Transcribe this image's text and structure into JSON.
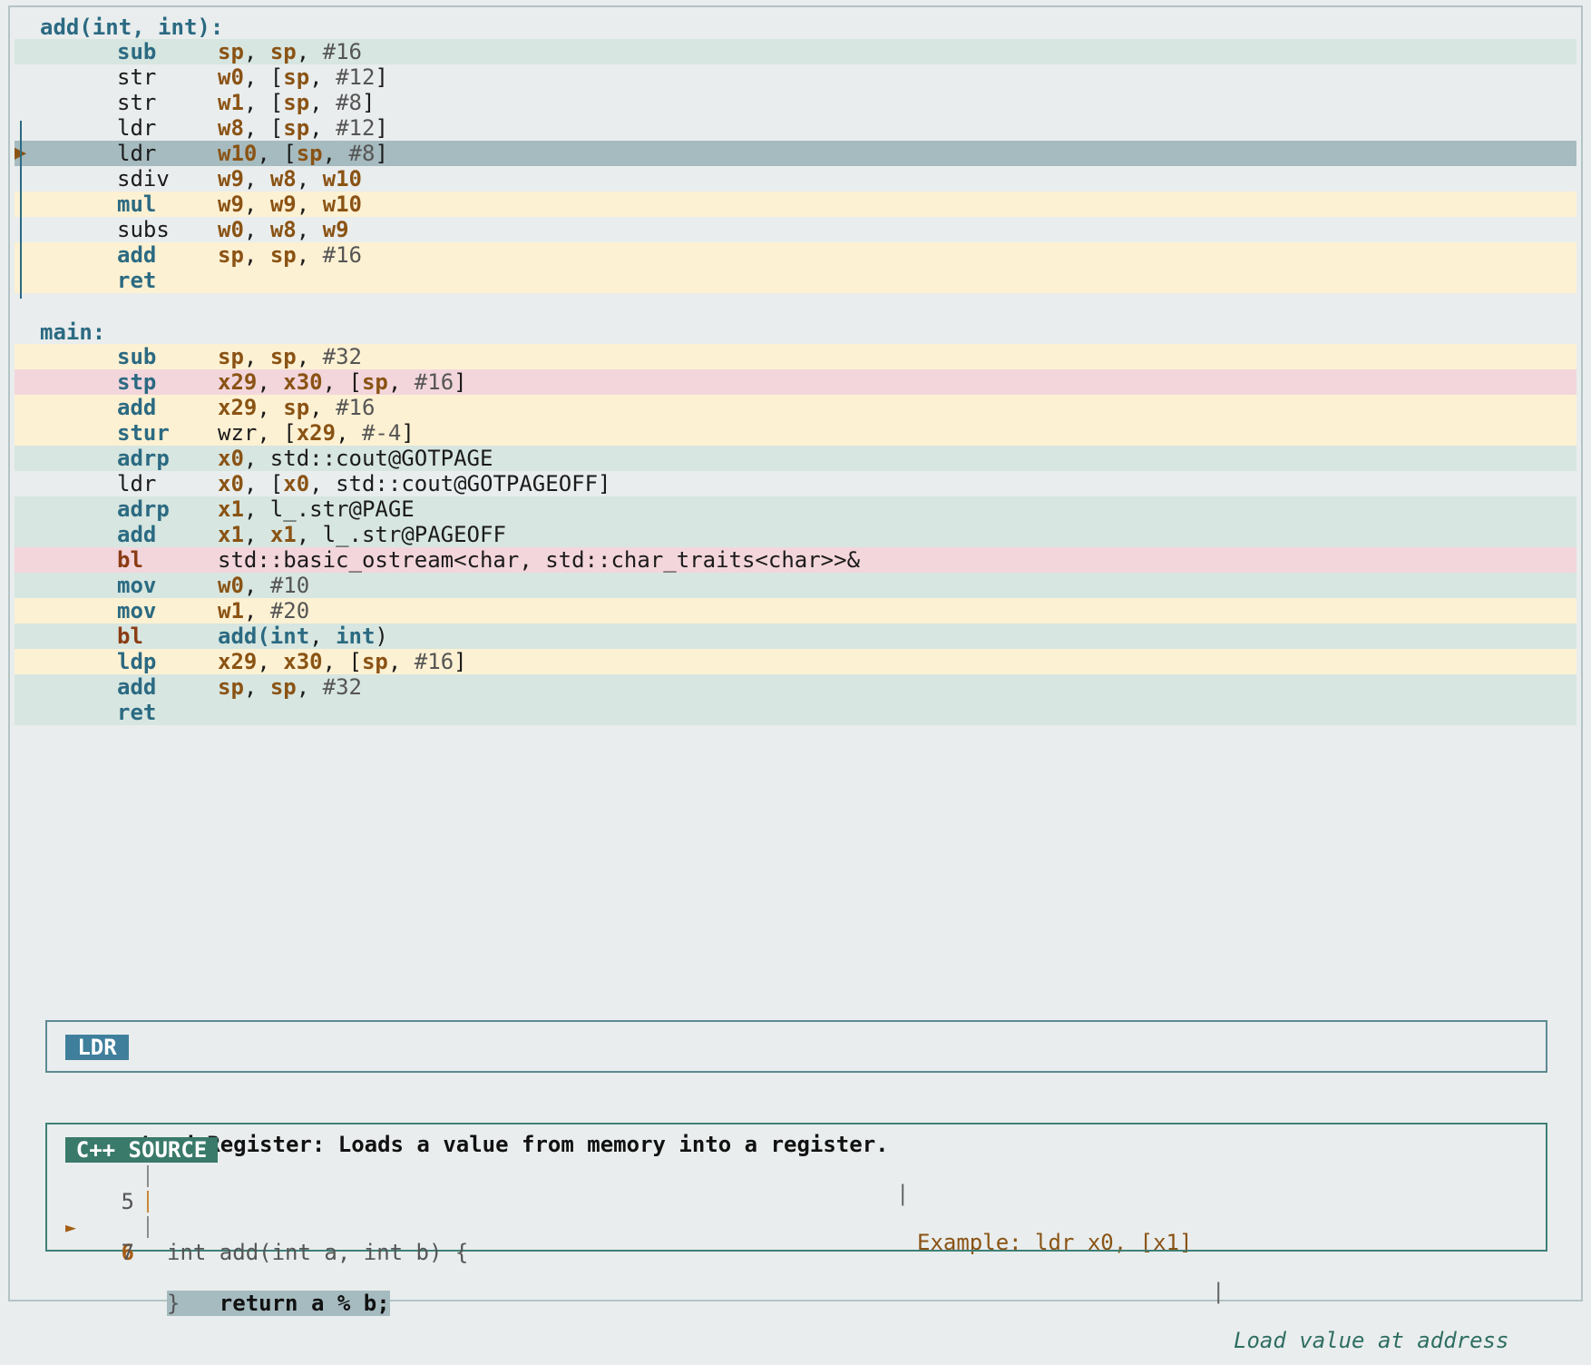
{
  "colors": {
    "green": "#d7e6e0",
    "yellow": "#fdf1d3",
    "pink": "#f3d6dc",
    "current": "#a6bbc0",
    "plain": "transparent"
  },
  "asm": {
    "labels": [
      "add(int, int):",
      "main:"
    ],
    "add_fn": [
      {
        "mn": "sub",
        "mnStyle": "b",
        "ops": [
          {
            "t": "sp",
            "c": "reg"
          },
          {
            "t": ", "
          },
          {
            "t": "sp",
            "c": "reg"
          },
          {
            "t": ", "
          },
          {
            "t": "#16",
            "c": "imm"
          }
        ],
        "bg": "green"
      },
      {
        "mn": "str",
        "mnStyle": "n",
        "ops": [
          {
            "t": "w0",
            "c": "reg"
          },
          {
            "t": ", ["
          },
          {
            "t": "sp",
            "c": "reg"
          },
          {
            "t": ", "
          },
          {
            "t": "#12",
            "c": "imm"
          },
          {
            "t": "]"
          }
        ],
        "bg": "plain"
      },
      {
        "mn": "str",
        "mnStyle": "n",
        "ops": [
          {
            "t": "w1",
            "c": "reg"
          },
          {
            "t": ", ["
          },
          {
            "t": "sp",
            "c": "reg"
          },
          {
            "t": ", "
          },
          {
            "t": "#8",
            "c": "imm"
          },
          {
            "t": "]"
          }
        ],
        "bg": "plain"
      },
      {
        "mn": "ldr",
        "mnStyle": "n",
        "ops": [
          {
            "t": "w8",
            "c": "reg"
          },
          {
            "t": ", ["
          },
          {
            "t": "sp",
            "c": "reg"
          },
          {
            "t": ", "
          },
          {
            "t": "#12",
            "c": "imm"
          },
          {
            "t": "]"
          }
        ],
        "bg": "plain"
      },
      {
        "mn": "ldr",
        "mnStyle": "n",
        "ops": [
          {
            "t": "w10",
            "c": "reg"
          },
          {
            "t": ", ["
          },
          {
            "t": "sp",
            "c": "reg"
          },
          {
            "t": ", "
          },
          {
            "t": "#8",
            "c": "imm"
          },
          {
            "t": "]"
          }
        ],
        "bg": "current",
        "pc": true
      },
      {
        "mn": "sdiv",
        "mnStyle": "n",
        "ops": [
          {
            "t": "w9",
            "c": "reg"
          },
          {
            "t": ", "
          },
          {
            "t": "w8",
            "c": "reg"
          },
          {
            "t": ", "
          },
          {
            "t": "w10",
            "c": "reg"
          }
        ],
        "bg": "plain"
      },
      {
        "mn": "mul",
        "mnStyle": "b",
        "ops": [
          {
            "t": "w9",
            "c": "reg"
          },
          {
            "t": ", "
          },
          {
            "t": "w9",
            "c": "reg"
          },
          {
            "t": ", "
          },
          {
            "t": "w10",
            "c": "reg"
          }
        ],
        "bg": "yellow"
      },
      {
        "mn": "subs",
        "mnStyle": "n",
        "ops": [
          {
            "t": "w0",
            "c": "reg"
          },
          {
            "t": ", "
          },
          {
            "t": "w8",
            "c": "reg"
          },
          {
            "t": ", "
          },
          {
            "t": "w9",
            "c": "reg"
          }
        ],
        "bg": "plain"
      },
      {
        "mn": "add",
        "mnStyle": "b",
        "ops": [
          {
            "t": "sp",
            "c": "reg"
          },
          {
            "t": ", "
          },
          {
            "t": "sp",
            "c": "reg"
          },
          {
            "t": ", "
          },
          {
            "t": "#16",
            "c": "imm"
          }
        ],
        "bg": "yellow"
      },
      {
        "mn": "ret",
        "mnStyle": "b",
        "ops": [],
        "bg": "yellow"
      }
    ],
    "main_fn": [
      {
        "mn": "sub",
        "mnStyle": "b",
        "ops": [
          {
            "t": "sp",
            "c": "reg"
          },
          {
            "t": ", "
          },
          {
            "t": "sp",
            "c": "reg"
          },
          {
            "t": ", "
          },
          {
            "t": "#32",
            "c": "imm"
          }
        ],
        "bg": "yellow"
      },
      {
        "mn": "stp",
        "mnStyle": "b",
        "ops": [
          {
            "t": "x29",
            "c": "reg"
          },
          {
            "t": ", "
          },
          {
            "t": "x30",
            "c": "reg"
          },
          {
            "t": ", ["
          },
          {
            "t": "sp",
            "c": "reg"
          },
          {
            "t": ", "
          },
          {
            "t": "#16",
            "c": "imm"
          },
          {
            "t": "]"
          }
        ],
        "bg": "pink"
      },
      {
        "mn": "add",
        "mnStyle": "b",
        "ops": [
          {
            "t": "x29",
            "c": "reg"
          },
          {
            "t": ", "
          },
          {
            "t": "sp",
            "c": "reg"
          },
          {
            "t": ", "
          },
          {
            "t": "#16",
            "c": "imm"
          }
        ],
        "bg": "yellow"
      },
      {
        "mn": "stur",
        "mnStyle": "b",
        "ops": [
          {
            "t": "wzr, ["
          },
          {
            "t": "x29",
            "c": "reg"
          },
          {
            "t": ", "
          },
          {
            "t": "#-4",
            "c": "imm"
          },
          {
            "t": "]"
          }
        ],
        "bg": "yellow"
      },
      {
        "mn": "adrp",
        "mnStyle": "b",
        "ops": [
          {
            "t": "x0",
            "c": "reg"
          },
          {
            "t": ", std::cout@GOTPAGE"
          }
        ],
        "bg": "green"
      },
      {
        "mn": "ldr",
        "mnStyle": "n",
        "ops": [
          {
            "t": "x0",
            "c": "reg"
          },
          {
            "t": ", ["
          },
          {
            "t": "x0",
            "c": "reg"
          },
          {
            "t": ", std::cout@GOTPAGEOFF]"
          }
        ],
        "bg": "plain"
      },
      {
        "mn": "adrp",
        "mnStyle": "b",
        "ops": [
          {
            "t": "x1",
            "c": "reg"
          },
          {
            "t": ", l_.str@PAGE"
          }
        ],
        "bg": "green"
      },
      {
        "mn": "add",
        "mnStyle": "b",
        "ops": [
          {
            "t": "x1",
            "c": "reg"
          },
          {
            "t": ", "
          },
          {
            "t": "x1",
            "c": "reg"
          },
          {
            "t": ", l_.str@PAGEOFF"
          }
        ],
        "bg": "green"
      },
      {
        "mn": "bl",
        "mnStyle": "r",
        "ops": [
          {
            "t": "std::basic_ostream<char, std::char_traits<char>>&"
          }
        ],
        "bg": "pink"
      },
      {
        "mn": "mov",
        "mnStyle": "b",
        "ops": [
          {
            "t": "w0",
            "c": "reg"
          },
          {
            "t": ", "
          },
          {
            "t": "#10",
            "c": "imm"
          }
        ],
        "bg": "green"
      },
      {
        "mn": "mov",
        "mnStyle": "b",
        "ops": [
          {
            "t": "w1",
            "c": "reg"
          },
          {
            "t": ", "
          },
          {
            "t": "#20",
            "c": "imm"
          }
        ],
        "bg": "yellow"
      },
      {
        "mn": "bl",
        "mnStyle": "r",
        "ops": [
          {
            "t": "add(",
            "c": "fn"
          },
          {
            "t": "int",
            "c": "fn"
          },
          {
            "t": ", "
          },
          {
            "t": "int",
            "c": "fn"
          },
          {
            "t": ")"
          }
        ],
        "bg": "green"
      },
      {
        "mn": "ldp",
        "mnStyle": "b",
        "ops": [
          {
            "t": "x29",
            "c": "reg"
          },
          {
            "t": ", "
          },
          {
            "t": "x30",
            "c": "reg"
          },
          {
            "t": ", ["
          },
          {
            "t": "sp",
            "c": "reg"
          },
          {
            "t": ", "
          },
          {
            "t": "#16",
            "c": "imm"
          },
          {
            "t": "]"
          }
        ],
        "bg": "yellow"
      },
      {
        "mn": "add",
        "mnStyle": "b",
        "ops": [
          {
            "t": "sp",
            "c": "reg"
          },
          {
            "t": ", "
          },
          {
            "t": "sp",
            "c": "reg"
          },
          {
            "t": ", "
          },
          {
            "t": "#32",
            "c": "imm"
          }
        ],
        "bg": "green"
      },
      {
        "mn": "ret",
        "mnStyle": "b",
        "ops": [],
        "bg": "green"
      }
    ]
  },
  "help": {
    "badge": "LDR",
    "description": "Load Register: Loads a value from memory into a register.",
    "separator": "|",
    "example": "Example: ldr x0, [x1]",
    "note": "Load value at address"
  },
  "source": {
    "badge": "C++ SOURCE",
    "marker": "►",
    "lines": [
      {
        "num": "5",
        "text": "int add(int a, int b) {",
        "current": false
      },
      {
        "num": "6",
        "text": "    return a % b;",
        "current": true
      },
      {
        "num": "7",
        "text": "}",
        "current": false
      }
    ]
  }
}
